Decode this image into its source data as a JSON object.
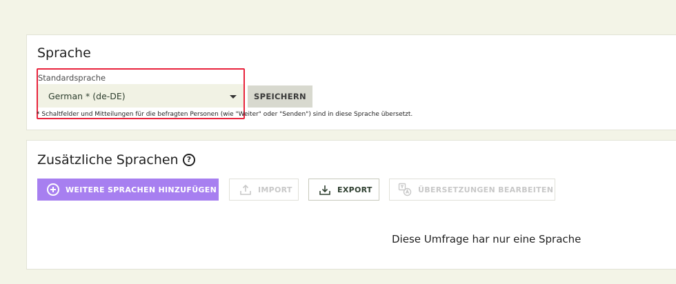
{
  "language_section": {
    "title": "Sprache",
    "field_label": "Standardsprache",
    "selected_language": "German * (de-DE)",
    "save_label": "SPEICHERN",
    "footnote": "* Schaltfelder und Mitteilungen für die befragten Personen (wie \"Weiter\" oder \"Senden\") sind in diese Sprache übersetzt."
  },
  "additional_section": {
    "title": "Zusätzliche Sprachen",
    "help_icon": "?",
    "buttons": {
      "add": "WEITERE SPRACHEN HINZUFÜGEN",
      "import": "IMPORT",
      "export": "EXPORT",
      "edit_translations": "ÜBERSETZUNGEN BEARBEITEN"
    },
    "empty_message": "Diese Umfrage har nur eine Sprache"
  },
  "icons": {
    "add": "plus-circle-icon",
    "import": "upload-icon",
    "export": "download-icon",
    "edit_translations": "translate-icon"
  },
  "colors": {
    "background": "#f3f4e7",
    "accent_purple": "#a77ff0",
    "highlight_red": "#e8223b",
    "select_bg": "#f1f2e4",
    "save_button_bg": "#d8d9cf"
  }
}
